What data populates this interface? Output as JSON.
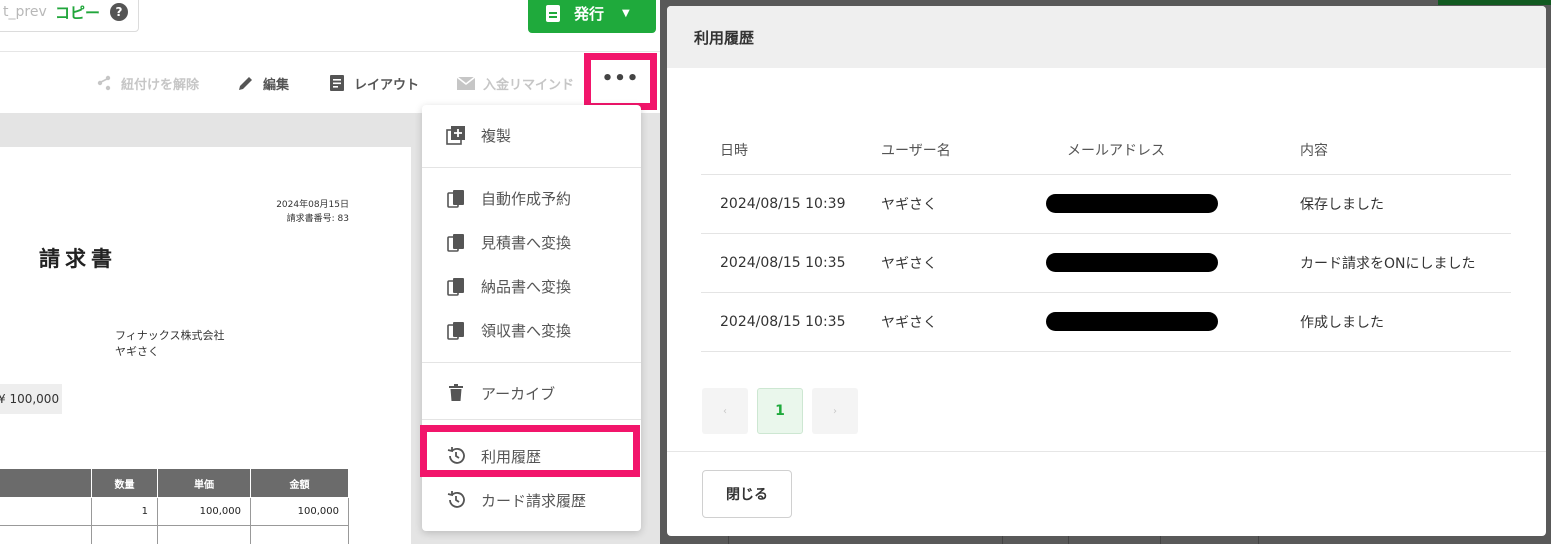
{
  "top": {
    "url_fragment": "t_prev",
    "copy_label": "コピー",
    "help_icon": "?",
    "issue_button": "発行"
  },
  "toolbar": {
    "unlink": "紐付けを解除",
    "edit": "編集",
    "layout": "レイアウト",
    "payment_reminder": "入金リマインド",
    "more": "•••"
  },
  "invoice": {
    "date": "2024年08月15日",
    "number": "請求書番号: 83",
    "title": "請求書",
    "company": "フィナックス株式会社",
    "person": "ヤギさく",
    "amount": "¥ 100,000",
    "headers": [
      "数量",
      "単価",
      "金額"
    ],
    "row1": [
      "1",
      "100,000",
      "100,000"
    ]
  },
  "menu": {
    "items": [
      {
        "label": "複製",
        "icon": "add-box-icon"
      },
      {
        "label": "自動作成予約",
        "icon": "copy-doc-icon"
      },
      {
        "label": "見積書へ変換",
        "icon": "copy-doc-icon"
      },
      {
        "label": "納品書へ変換",
        "icon": "copy-doc-icon"
      },
      {
        "label": "領収書へ変換",
        "icon": "copy-doc-icon"
      },
      {
        "label": "アーカイブ",
        "icon": "trash-icon"
      },
      {
        "label": "利用履歴",
        "icon": "history-icon"
      },
      {
        "label": "カード請求履歴",
        "icon": "history-icon"
      }
    ]
  },
  "modal": {
    "title": "利用履歴",
    "columns": [
      "日時",
      "ユーザー名",
      "メールアドレス",
      "内容"
    ],
    "rows": [
      {
        "datetime": "2024/08/15 10:39",
        "user": "ヤギさく",
        "content": "保存しました"
      },
      {
        "datetime": "2024/08/15 10:35",
        "user": "ヤギさく",
        "content": "カード請求をONにしました"
      },
      {
        "datetime": "2024/08/15 10:35",
        "user": "ヤギさく",
        "content": "作成しました"
      }
    ],
    "pagination": {
      "prev": "‹",
      "current": "1",
      "next": "›"
    },
    "close_button": "閉じる"
  },
  "colors": {
    "accent_green": "#1faa3c",
    "highlight_pink": "#f2156b"
  }
}
